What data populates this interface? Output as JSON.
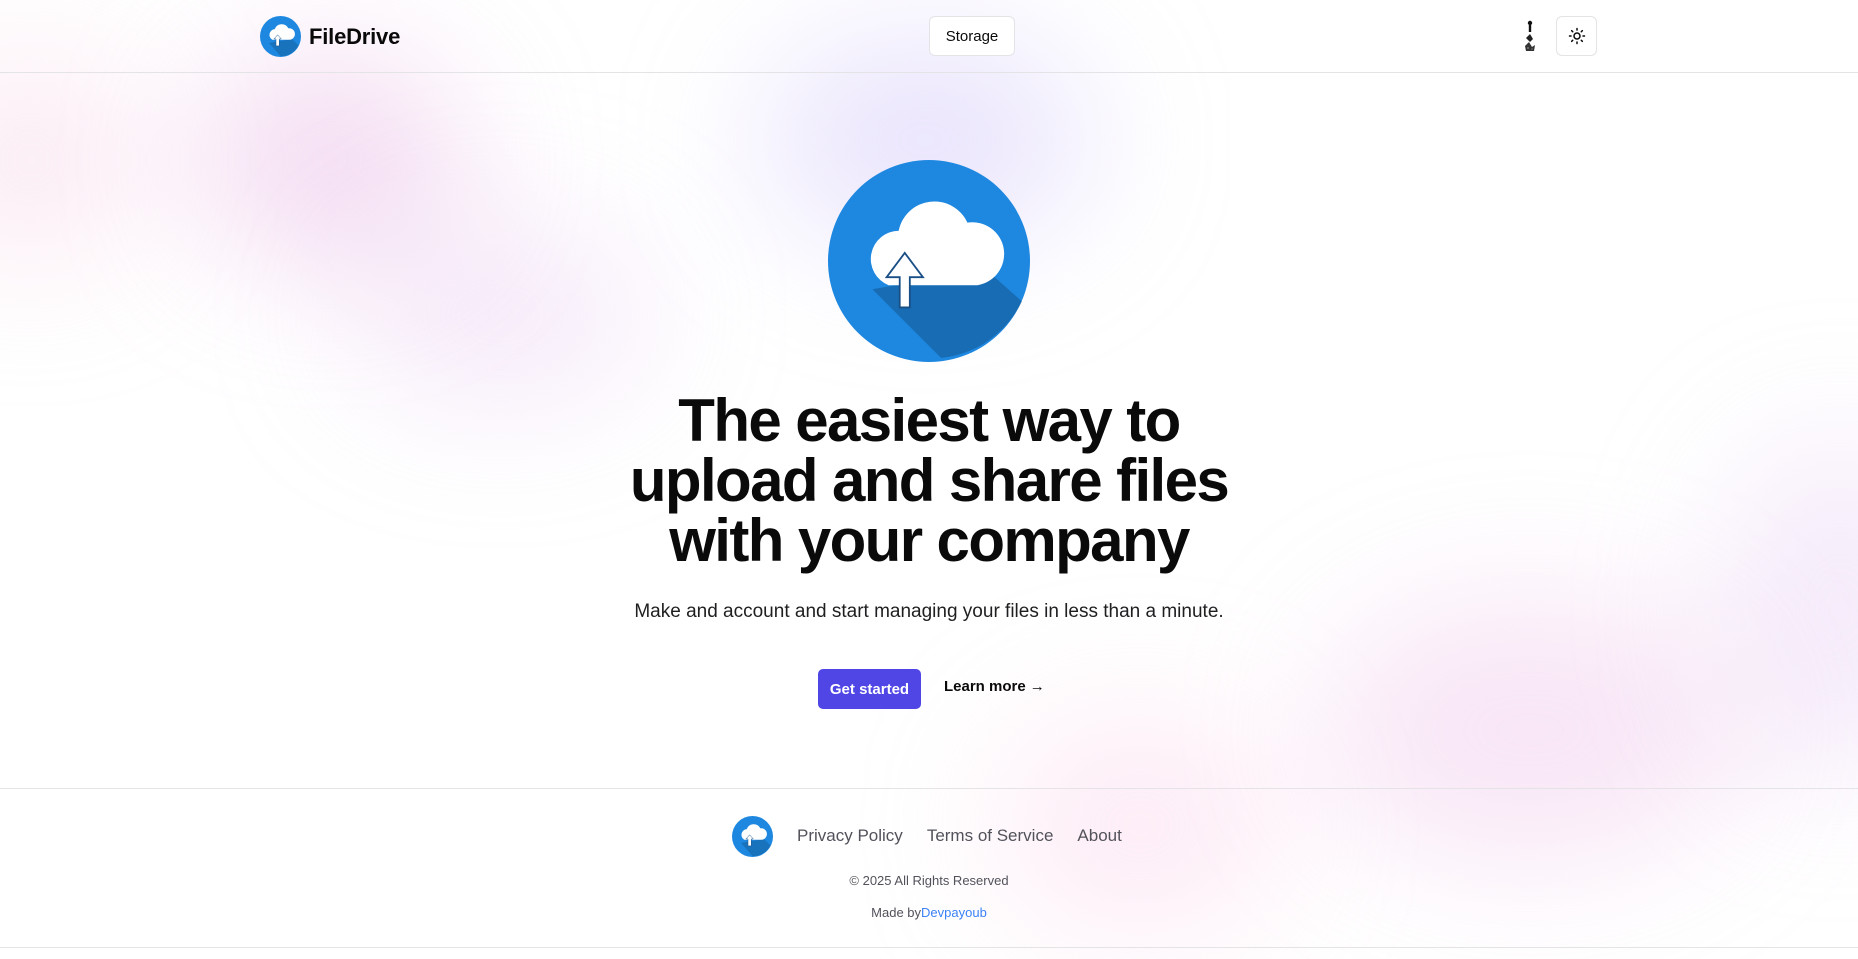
{
  "header": {
    "brand_name": "FileDrive",
    "storage_label": "Storage"
  },
  "hero": {
    "title_line1": "The easiest way to",
    "title_line2": "upload and share files",
    "title_line3": "with your company",
    "subtitle": "Make and account and start managing your files in less than a minute.",
    "cta_primary": "Get started",
    "cta_secondary": "Learn more",
    "cta_secondary_arrow": "→"
  },
  "footer": {
    "links": [
      "Privacy Policy",
      "Terms of Service",
      "About"
    ],
    "copyright": "© 2025 All Rights Reserved",
    "made_by_prefix": "Made by",
    "made_by_name": "Devpayoub"
  },
  "icons": {
    "logo": "cloud-upload-icon",
    "avatar": "user-avatar",
    "theme": "sun-icon"
  },
  "colors": {
    "brand_blue": "#1e88e0",
    "primary_button": "#4f46e5",
    "link_blue": "#3b82f6",
    "border": "#e4e4e7",
    "muted_text": "#52525b"
  }
}
